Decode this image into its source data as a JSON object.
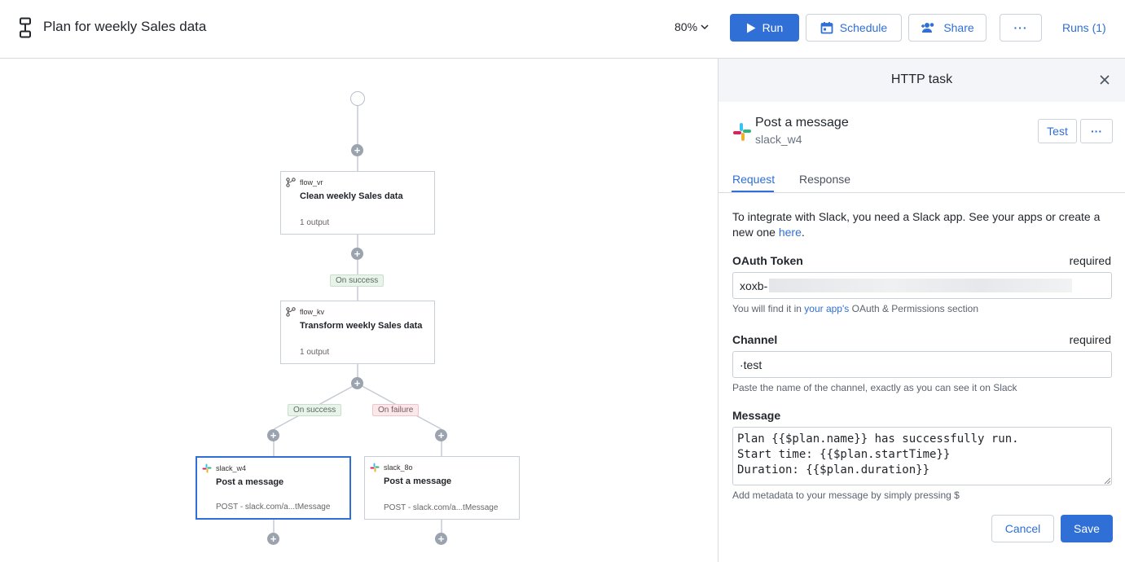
{
  "header": {
    "title": "Plan for weekly Sales data",
    "zoom": "80%",
    "run_label": "Run",
    "schedule_label": "Schedule",
    "share_label": "Share",
    "more_label": "···",
    "runs_label": "Runs (1)"
  },
  "flow": {
    "edge_labels": {
      "success_1": "On success",
      "success_2": "On success",
      "failure": "On failure"
    },
    "nodes": [
      {
        "id": "flow_vr",
        "title": "Clean weekly Sales data",
        "footer": "1 output"
      },
      {
        "id": "flow_kv",
        "title": "Transform weekly Sales data",
        "footer": "1 output"
      },
      {
        "id": "slack_w4",
        "title": "Post a message",
        "footer": "POST - slack.com/a...tMessage"
      },
      {
        "id": "slack_8o",
        "title": "Post a message",
        "footer": "POST - slack.com/a...tMessage"
      }
    ]
  },
  "panel": {
    "title": "HTTP task",
    "task_name": "Post a message",
    "task_id": "slack_w4",
    "test_label": "Test",
    "more_label": "···",
    "tabs": [
      "Request",
      "Response"
    ],
    "intro_text": "To integrate with Slack, you need a Slack app. See your apps or create a new one ",
    "intro_link": "here",
    "intro_end": ".",
    "oauth": {
      "label": "OAuth Token",
      "required": "required",
      "value": "xoxb-",
      "hint_prefix": "You will find it in ",
      "hint_link": "your app's",
      "hint_suffix": " OAuth & Permissions section"
    },
    "channel": {
      "label": "Channel",
      "required": "required",
      "value": "·test",
      "hint": "Paste the name of the channel, exactly as you can see it on Slack"
    },
    "message": {
      "label": "Message",
      "value": "Plan {{$plan.name}} has successfully run.\nStart time: {{$plan.startTime}}\nDuration: {{$plan.duration}}",
      "hint": "Add metadata to your message by simply pressing $"
    },
    "cancel_label": "Cancel",
    "save_label": "Save"
  },
  "colors": {
    "accent": "#2f6fd6",
    "success_bg": "#e8f3ea",
    "failure_bg": "#fbe8ea"
  }
}
